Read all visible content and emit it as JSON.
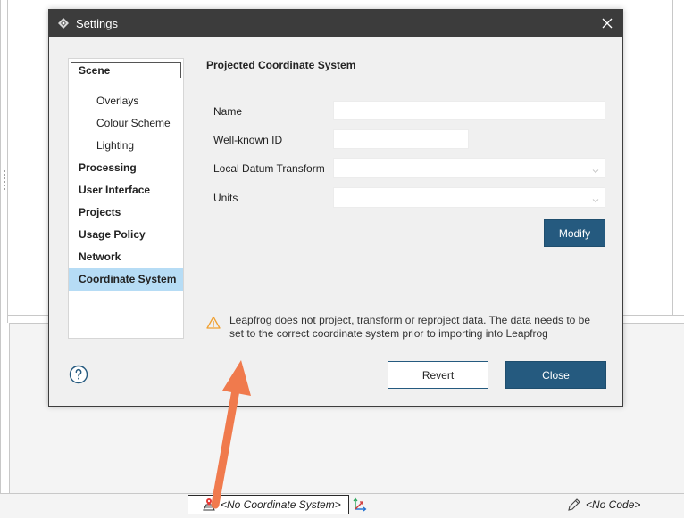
{
  "dialog": {
    "title": "Settings",
    "close_label": "×"
  },
  "nav": {
    "items": [
      {
        "label": "Scene"
      },
      {
        "label": "Overlays"
      },
      {
        "label": "Colour Scheme"
      },
      {
        "label": "Lighting"
      },
      {
        "label": "Processing"
      },
      {
        "label": "User Interface"
      },
      {
        "label": "Projects"
      },
      {
        "label": "Usage Policy"
      },
      {
        "label": "Network"
      },
      {
        "label": "Coordinate System"
      }
    ]
  },
  "panel": {
    "section_title": "Projected Coordinate System",
    "fields": {
      "name_label": "Name",
      "name_value": "",
      "wkid_label": "Well-known ID",
      "wkid_value": "",
      "datum_label": "Local Datum Transform",
      "datum_value": "",
      "units_label": "Units",
      "units_value": ""
    },
    "modify_label": "Modify",
    "warning": "Leapfrog does not project, transform or reproject data. The data needs to be set to the correct coordinate system prior to importing into Leapfrog"
  },
  "footer": {
    "revert_label": "Revert",
    "close_label": "Close"
  },
  "statusbar": {
    "coordinate_system": "<No Coordinate System>",
    "code": "<No Code>"
  },
  "colors": {
    "accent": "#255a7f",
    "selection": "#b6dcf5",
    "titlebar": "#3c3c3c",
    "annotation_arrow": "#f07a4d"
  }
}
